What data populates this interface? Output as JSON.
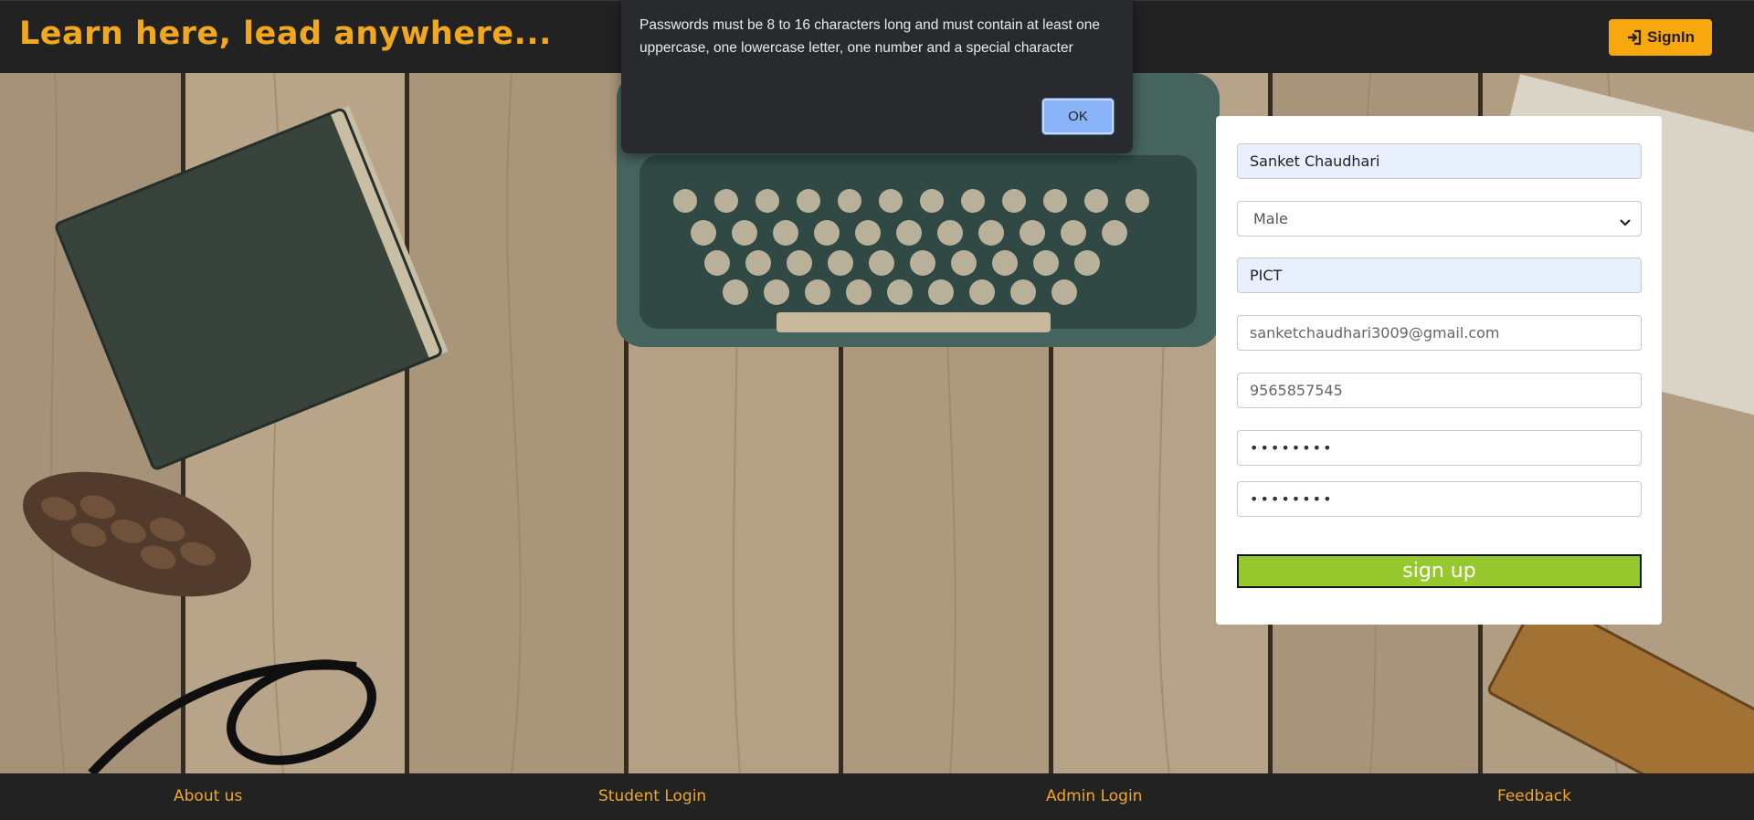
{
  "header": {
    "brand": "Learn here, lead anywhere...",
    "signin_label": "SignIn"
  },
  "dialog": {
    "message": "Passwords must be 8 to 16 characters long and must contain at least one uppercase, one lowercase letter, one number and a special character",
    "ok_label": "OK"
  },
  "form": {
    "name_value": "Sanket Chaudhari",
    "gender_selected": "Male",
    "college_value": "PICT",
    "email_value": "sanketchaudhari3009@gmail.com",
    "phone_value": "9565857545",
    "password_value": "••••••••",
    "confirm_password_value": "••••••••",
    "signup_label": "sign up"
  },
  "footer": {
    "links": [
      "About us",
      "Student Login",
      "Admin Login",
      "Feedback"
    ]
  },
  "colors": {
    "brand_orange": "#f2a81e",
    "signin_bg": "#f8a70f",
    "signup_green": "#97c92f",
    "bar_dark": "#222222",
    "dialog_bg": "#292a2d",
    "ok_blue": "#8ab4f8"
  },
  "icons": {
    "signin": "sign-in-icon",
    "select": "chevron-down-icon"
  }
}
